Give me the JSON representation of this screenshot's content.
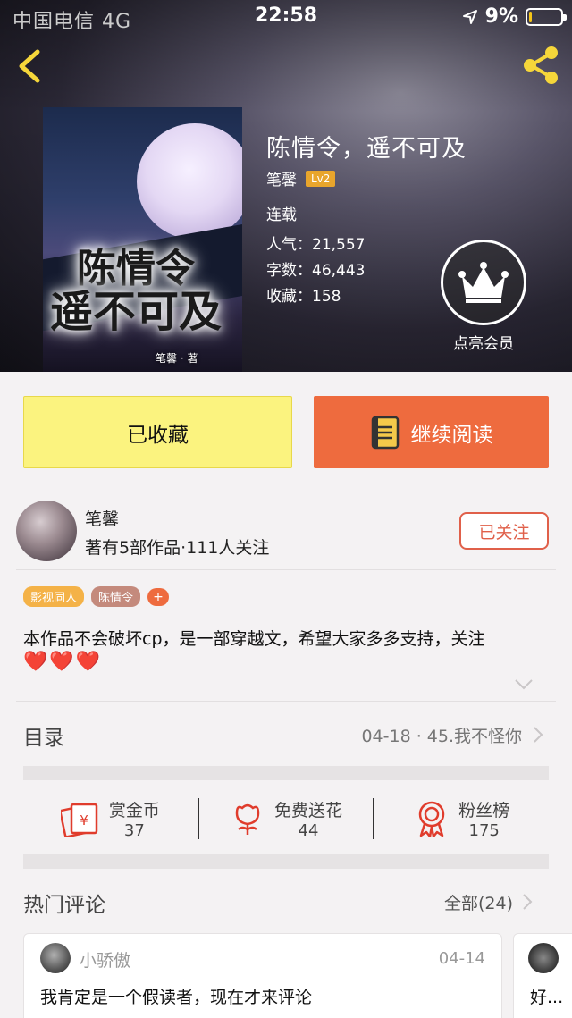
{
  "status_bar": {
    "carrier": "中国电信  4G",
    "time": "22:58",
    "battery": "9%",
    "battery_level": 0.09
  },
  "book": {
    "title": "陈情令，遥不可及",
    "cover_title_line1": "陈情令",
    "cover_title_line2": "遥不可及",
    "cover_author": "笔馨 · 著",
    "author": "笔馨",
    "level": "Lv2",
    "status": "连载",
    "popularity": "人气：21,557",
    "words": "字数：46,443",
    "favorites": "收藏：158"
  },
  "vip": {
    "label": "点亮会员",
    "icon": "crown-icon"
  },
  "actions": {
    "collected": "已收藏",
    "read": "继续阅读"
  },
  "author_info": {
    "name": "笔馨",
    "stats": "著有5部作品·111人关注",
    "follow": "已关注"
  },
  "tags": [
    "影视同人",
    "陈情令"
  ],
  "tag_add": "+",
  "description": "本作品不会破坏cp，是一部穿越文，希望大家多多支持，关注",
  "hearts": "❤️❤️❤️",
  "catalog": {
    "label": "目录",
    "latest": "04-18 · 45.我不怪你"
  },
  "stats": [
    {
      "label": "赏金币",
      "value": "37",
      "icon": "red-envelope-icon"
    },
    {
      "label": "免费送花",
      "value": "44",
      "icon": "flower-icon"
    },
    {
      "label": "粉丝榜",
      "value": "175",
      "icon": "medal-icon"
    }
  ],
  "comments": {
    "label": "热门评论",
    "all": "全部(24)",
    "items": [
      {
        "user": "小骄傲",
        "date": "04-14",
        "text": "我肯定是一个假读者，现在才来评论"
      },
      {
        "text": "好..."
      }
    ]
  },
  "colors": {
    "accent_orange": "#ee6b3e",
    "accent_yellow": "#fbf37f",
    "follow_red": "#e0604a"
  }
}
